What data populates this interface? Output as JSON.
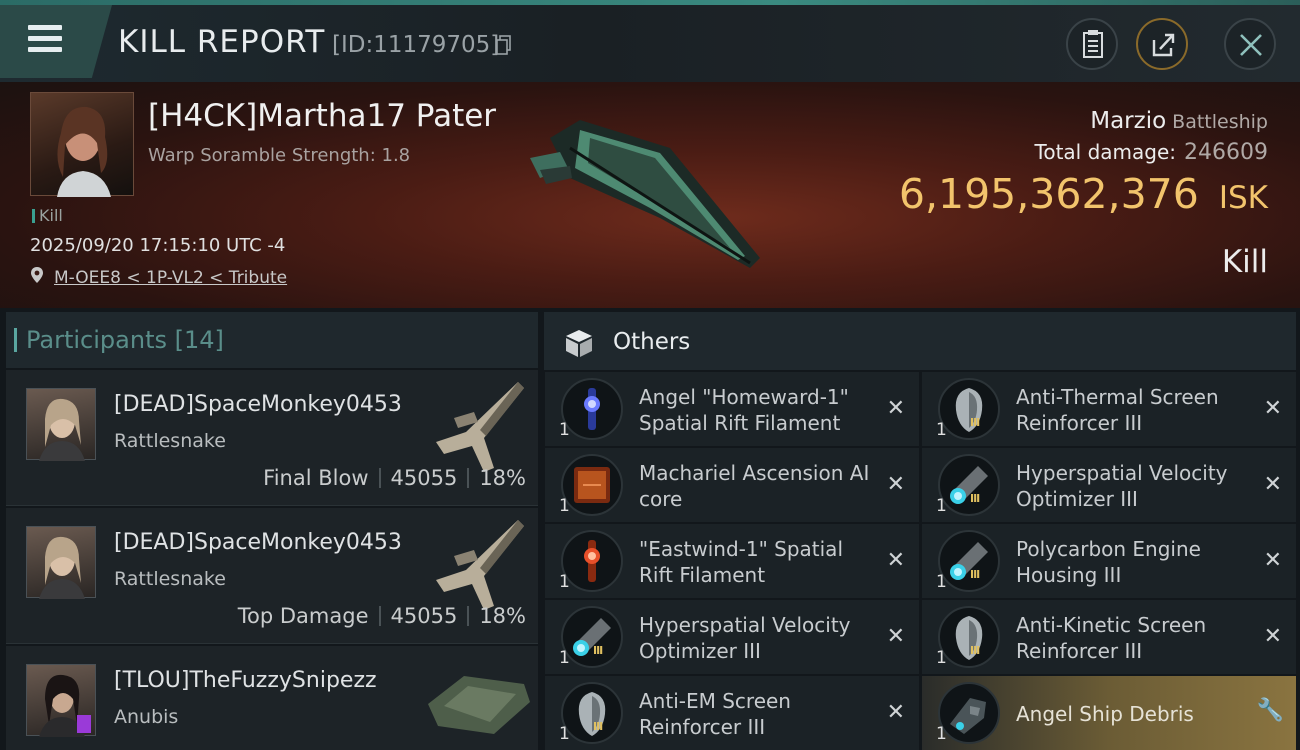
{
  "header": {
    "title": "KILL REPORT",
    "kill_id": "[ID:11179705]"
  },
  "victim": {
    "name": "[H4CK]Martha17 Pater",
    "warp_scramble": "Warp Soramble Strength: 1.8",
    "tag": "Kill",
    "datetime": "2025/09/20 17:15:10 UTC -4",
    "location": "M-OEE8 < 1P-VL2 < Tribute",
    "ship_name": "Marzio",
    "ship_class": "Battleship",
    "total_damage_label": "Total damage:",
    "total_damage": "246609",
    "isk_value": "6,195,362,376",
    "isk_unit": "ISK",
    "result": "Kill"
  },
  "participants": {
    "title": "Participants",
    "count": "[14]",
    "rows": [
      {
        "name": "[DEAD]SpaceMonkey0453",
        "ship": "Rattlesnake",
        "role": "Final Blow",
        "damage": "45055",
        "percent": "18%"
      },
      {
        "name": "[DEAD]SpaceMonkey0453",
        "ship": "Rattlesnake",
        "role": "Top Damage",
        "damage": "45055",
        "percent": "18%"
      },
      {
        "name": "[TLOU]TheFuzzySnipezz",
        "ship": "Anubis"
      }
    ]
  },
  "others": {
    "title": "Others",
    "items": [
      {
        "name": "Angel \"Homeward-1\" Spatial Rift Filament",
        "qty": "1",
        "icon": "blue-filament-icon",
        "action": "remove"
      },
      {
        "name": "Anti-Thermal Screen Reinforcer III",
        "qty": "1",
        "icon": "shield-rig-icon",
        "action": "remove"
      },
      {
        "name": "Machariel Ascension AI core",
        "qty": "1",
        "icon": "ai-core-icon",
        "action": "remove"
      },
      {
        "name": "Hyperspatial Velocity Optimizer III",
        "qty": "1",
        "icon": "engine-rig-icon",
        "action": "remove"
      },
      {
        "name": "\"Eastwind-1\" Spatial Rift Filament",
        "qty": "1",
        "icon": "red-filament-icon",
        "action": "remove"
      },
      {
        "name": "Polycarbon Engine Housing III",
        "qty": "1",
        "icon": "engine-rig-icon",
        "action": "remove"
      },
      {
        "name": "Hyperspatial Velocity Optimizer III",
        "qty": "1",
        "icon": "engine-rig-icon",
        "action": "remove"
      },
      {
        "name": "Anti-Kinetic Screen Reinforcer III",
        "qty": "1",
        "icon": "shield-rig-icon",
        "action": "remove"
      },
      {
        "name": "Anti-EM Screen Reinforcer III",
        "qty": "1",
        "icon": "shield-rig-icon",
        "action": "remove"
      },
      {
        "name": "Angel Ship Debris",
        "qty": "1",
        "icon": "debris-icon",
        "action": "repair"
      }
    ]
  },
  "colors": {
    "accent": "#3a8a80",
    "isk": "#f2c46c",
    "highlight": "#8a7440"
  }
}
